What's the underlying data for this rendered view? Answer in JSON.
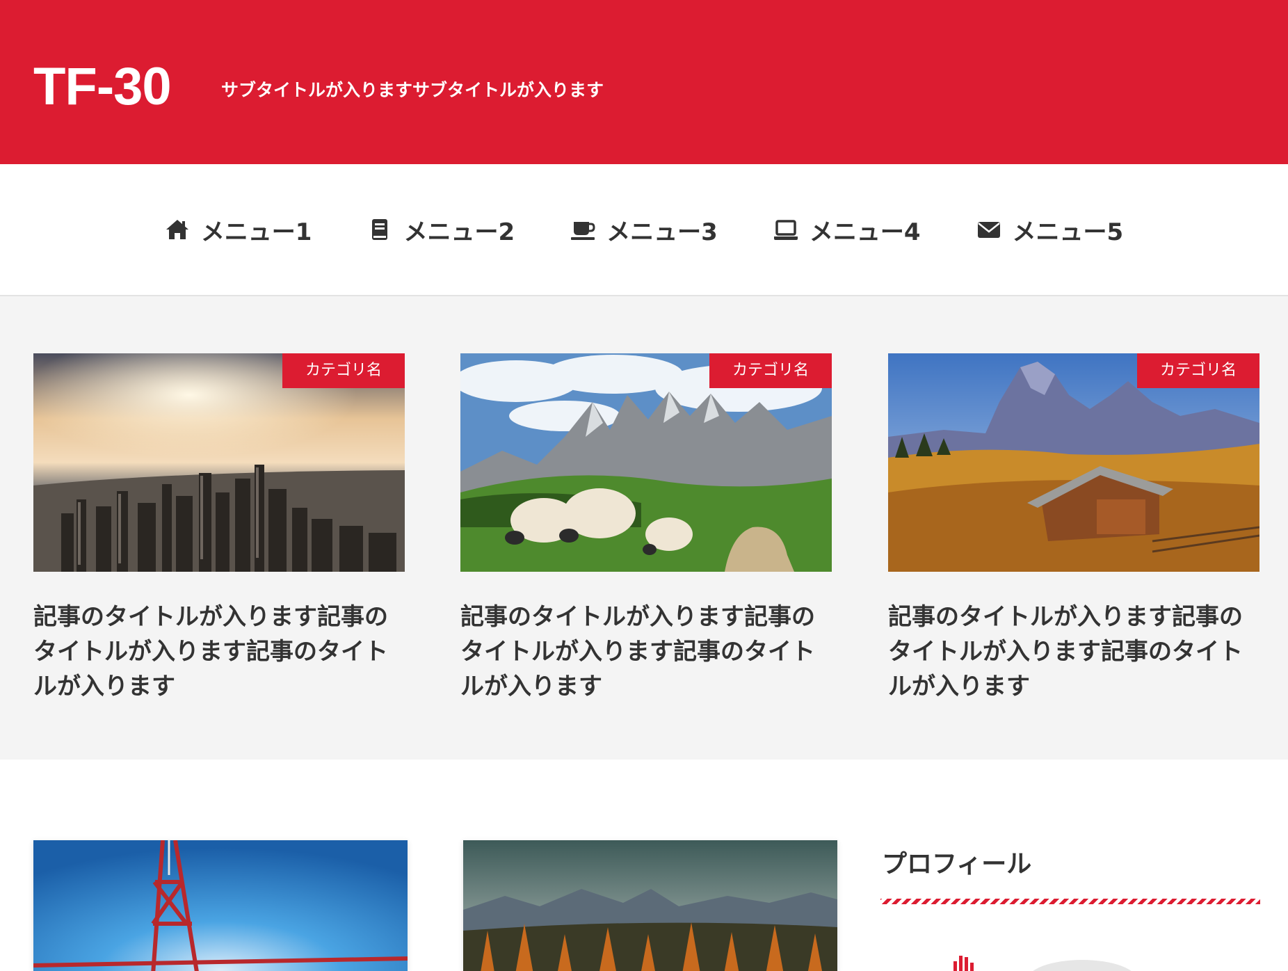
{
  "header": {
    "title": "TF-30",
    "subtitle": "サブタイトルが入りますサブタイトルが入ります"
  },
  "nav": {
    "items": [
      {
        "label": "メニュー1",
        "icon": "home-icon"
      },
      {
        "label": "メニュー2",
        "icon": "book-icon"
      },
      {
        "label": "メニュー3",
        "icon": "coffee-icon"
      },
      {
        "label": "メニュー4",
        "icon": "laptop-icon"
      },
      {
        "label": "メニュー5",
        "icon": "envelope-icon"
      }
    ]
  },
  "featured": {
    "posts": [
      {
        "category": "カテゴリ名",
        "title": "記事のタイトルが入ります記事のタイトルが入ります記事のタイトルが入ります"
      },
      {
        "category": "カテゴリ名",
        "title": "記事のタイトルが入ります記事のタイトルが入ります記事のタイトルが入ります"
      },
      {
        "category": "カテゴリ名",
        "title": "記事のタイトルが入ります記事のタイトルが入ります記事のタイトルが入ります"
      }
    ]
  },
  "sidebar": {
    "widget_title": "プロフィール"
  },
  "colors": {
    "accent": "#dc1c31",
    "text": "#333333",
    "section_bg": "#f4f4f4"
  }
}
